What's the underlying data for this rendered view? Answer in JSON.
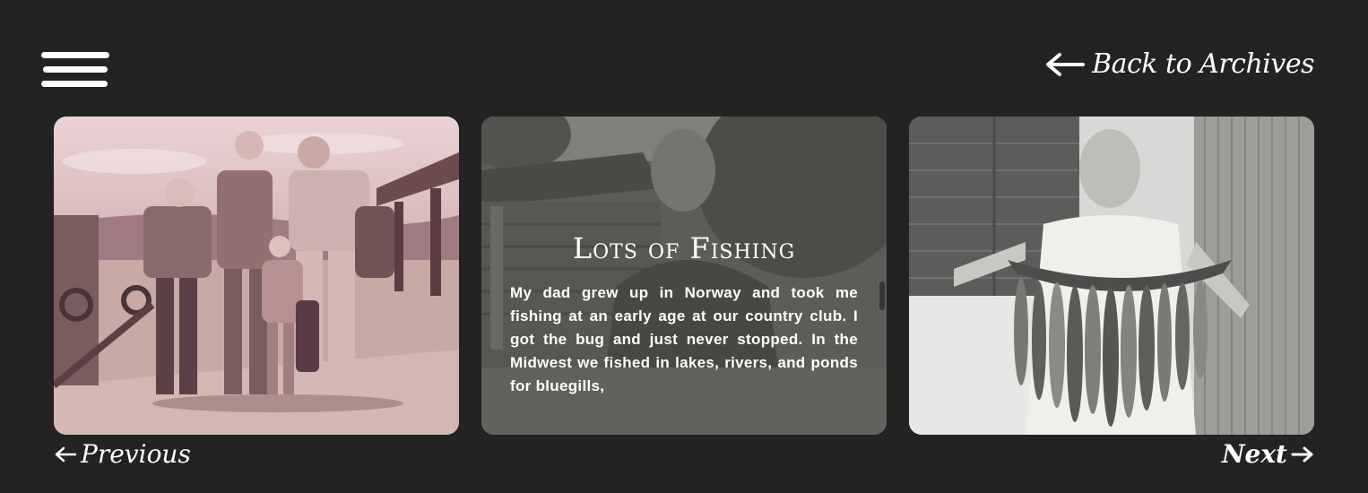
{
  "header": {
    "menu_icon": "hamburger-menu-icon",
    "back_label": "Back to Archives",
    "back_icon": "arrow-left-icon"
  },
  "gallery": {
    "cards": [
      {
        "alt": "family-photo"
      },
      {
        "title": "Lots of Fishing",
        "text": "My dad grew up in Norway and took me fishing at an early age at our country club. I got the bug and just never stopped. In the Midwest we fished in lakes, rivers, and ponds for bluegills,"
      },
      {
        "alt": "boy-with-fish-photo"
      }
    ]
  },
  "pager": {
    "previous_label": "Previous",
    "next_label": "Next"
  },
  "colors": {
    "background": "#232323",
    "text": "#ffffff",
    "overlay": "rgba(60,60,58,0.52)"
  }
}
